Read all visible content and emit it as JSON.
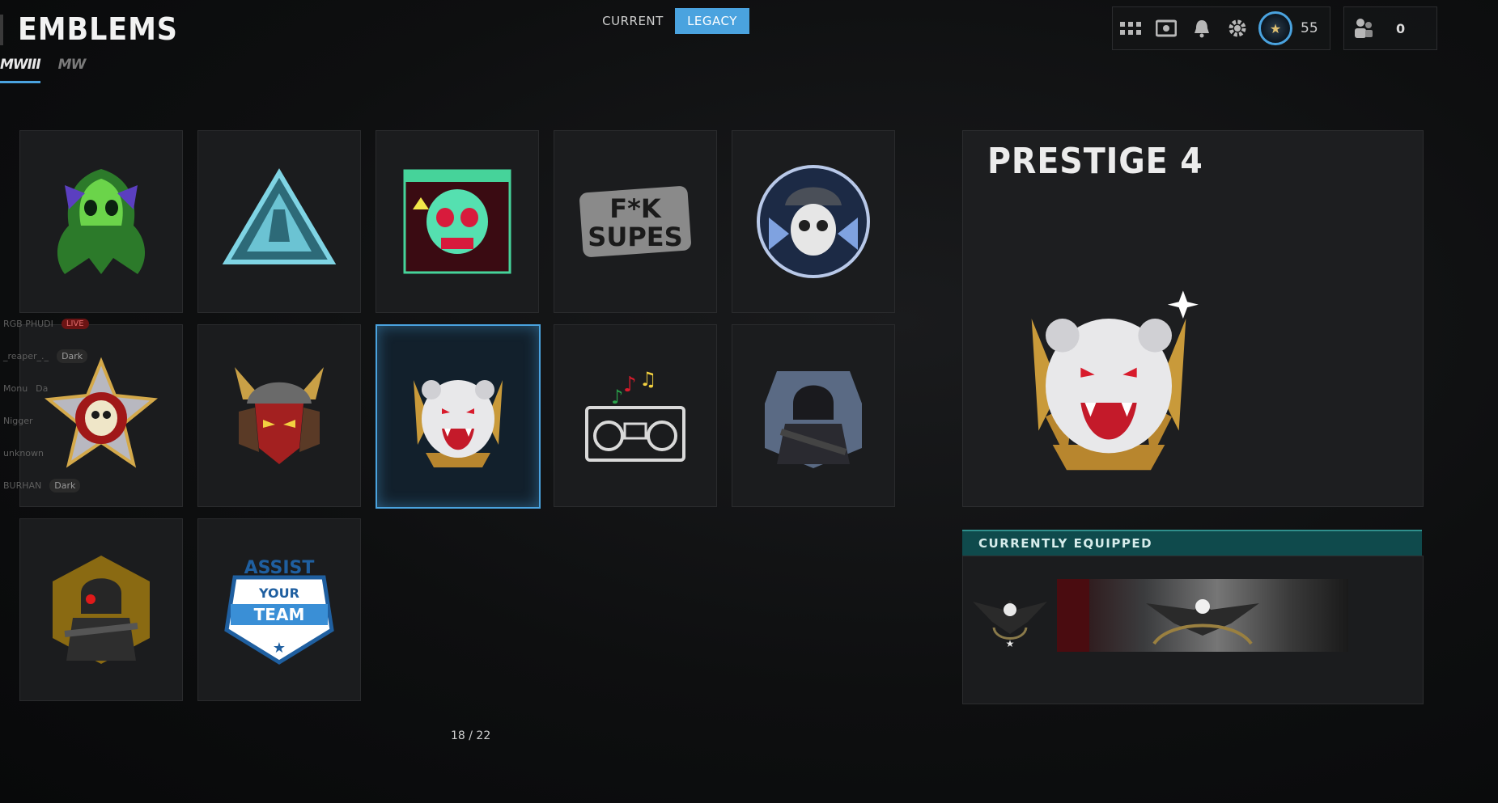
{
  "header": {
    "title": "EMBLEMS",
    "game_tabs": [
      {
        "label": "MWIII",
        "active": true
      },
      {
        "label": "MW",
        "active": false
      }
    ],
    "mode_tabs": [
      {
        "label": "CURRENT",
        "active": false
      },
      {
        "label": "LEGACY",
        "active": true
      }
    ]
  },
  "topbar": {
    "icons": [
      "grid-menu-icon",
      "theater-icon",
      "bell-icon",
      "gear-icon"
    ],
    "prestige_icon": "prestige-badge-icon",
    "level": "55",
    "party_icon": "party-icon",
    "party_count": "0"
  },
  "emblems": [
    {
      "icon": "ghost-reaper-emblem",
      "selected": false
    },
    {
      "icon": "triangle-soldier-emblem",
      "selected": false
    },
    {
      "icon": "cyber-skull-emblem",
      "selected": false
    },
    {
      "icon": "f-k-supes-emblem",
      "selected": false
    },
    {
      "icon": "ice-skull-soldier-emblem",
      "selected": false
    },
    {
      "icon": "skull-star-medal-emblem",
      "selected": false
    },
    {
      "icon": "samurai-helmet-emblem",
      "selected": false
    },
    {
      "icon": "polar-bear-emblem",
      "selected": true
    },
    {
      "icon": "boombox-emblem",
      "selected": false
    },
    {
      "icon": "hooded-operator-emblem",
      "selected": false
    },
    {
      "icon": "masked-soldier-emblem",
      "selected": false
    },
    {
      "icon": "assist-your-team-emblem",
      "selected": false
    }
  ],
  "overlay": {
    "rows": [
      {
        "name": "RGB PHUDI",
        "tag": "LIVE"
      },
      {
        "name": "_reaper_._",
        "tag": "Dark"
      },
      {
        "name": "Monu",
        "tag": "Da"
      },
      {
        "name": "Nigger",
        "tag": ""
      },
      {
        "name": "unknown",
        "tag": ""
      },
      {
        "name": "BURHAN",
        "tag": "Dark"
      }
    ]
  },
  "pagination": "18 / 22",
  "detail": {
    "title": "PRESTIGE 4",
    "emblem_icon": "polar-bear-emblem"
  },
  "equipped": {
    "header": "CURRENTLY EQUIPPED",
    "emblem_icon": "eagle-emblem",
    "calling_card_icon": "eagle-calling-card"
  },
  "colors": {
    "accent": "#4aa3df",
    "equipped_header": "#0f4a4c"
  }
}
